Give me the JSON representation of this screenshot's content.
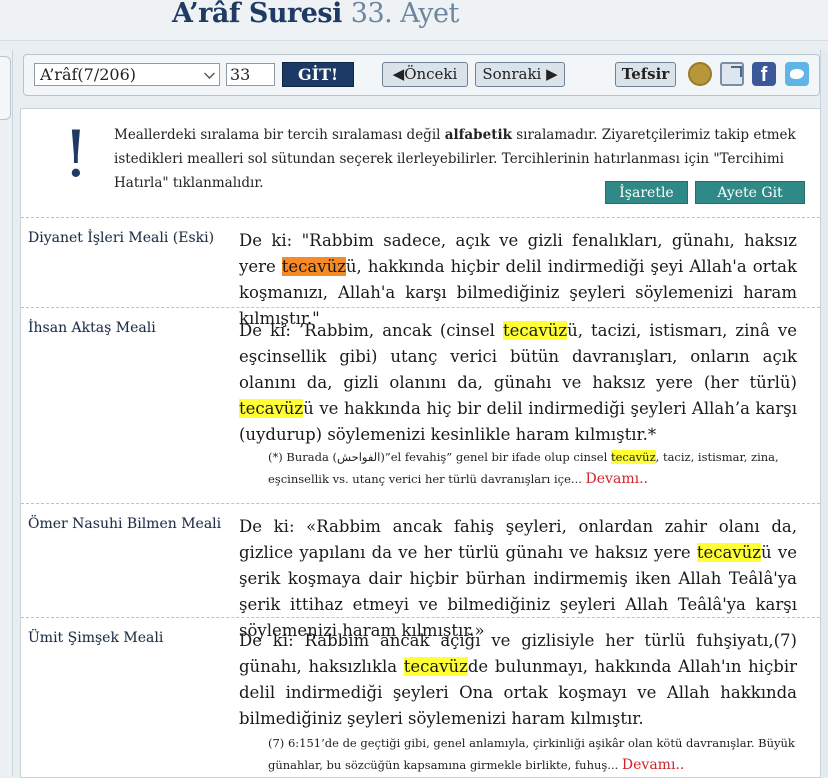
{
  "header": {
    "surah_title": "A’râf Suresi",
    "ayah_title": "33. Ayet"
  },
  "toolbar": {
    "surah_select_value": "A’râf(7/206)",
    "ayah_input_value": "33",
    "go_label": "GİT!",
    "prev_label": "◀Önceki",
    "next_label": "Sonraki ▶",
    "tefsir_label": "Tefsir",
    "fb_label": "f"
  },
  "notice": {
    "icon": "!",
    "part1": "Meallerdeki sıralama bir tercih sıralaması değil ",
    "bold": "alfabetik",
    "part2": " sıralamadır. Ziyaretçilerimiz takip etmek istedikleri mealleri sol sütundan seçerek ilerleyebilirler. Tercihlerinin hatırlanması için \"Tercihimi Hatırla\" tıklanmalıdır.",
    "mark_label": "İşaretle",
    "goto_label": "Ayete Git"
  },
  "translations": [
    {
      "name": "Diyanet İşleri Meali (Eski)",
      "pre": "De ki: \"Rabbim sadece, açık ve gizli fenalıkları, günahı, haksız yere ",
      "hl": "tecavüz",
      "post": "ü, hakkında hiçbir delil indirmediği şeyi Allah'a ortak koşmanızı, Allah'a karşı bilmediğiniz şeyleri söylemenizi haram kılmıştır.\""
    },
    {
      "name": "İhsan Aktaş Meali",
      "pre": "De ki: ’Rabbim, ancak (cinsel ",
      "hl": "tecavüz",
      "mid": "ü, tacizi, istismarı, zinâ ve eşcinsellik gibi) utanç verici bütün davranışları, onların açık olanını da, gizli olanını da, günahı ve haksız yere (her türlü) ",
      "hl2": "tecavüz",
      "post": "ü ve hakkında hiç bir delil indirmediği şeyleri Allah’a karşı (uydurup) söylemenizi kesinlikle haram kılmıştır.*",
      "note_pre": "(*) Burada (الفواحش)”el fevahiş” genel bir ifade olup cinsel ",
      "note_hl": "tecavüz",
      "note_post": ", taciz, istismar, zina, eşcinsellik vs. utanç verici her türlü davranışları içe...",
      "more": "Devamı.."
    },
    {
      "name": "Ömer Nasuhi Bilmen Meali",
      "pre": "De ki: «Rabbim ancak fahiş şeyleri, onlardan zahir olanı da, gizlice yapılanı da ve her türlü günahı ve haksız yere ",
      "hl": "tecavüz",
      "post": "ü ve şerik koşmaya dair hiçbir bürhan indirmemiş iken Allah Teâlâ'ya şerik ittihaz etmeyi ve bilmediğiniz şeyleri Allah Teâlâ'ya karşı söylemenizi haram kılmıştır.»"
    },
    {
      "name": "Ümit Şimşek Meali",
      "pre": "De ki: Rabbim ancak açığı ve gizlisiyle her türlü fuhşiyatı,(7) günahı, haksızlıkla ",
      "hl": "tecavüz",
      "post": "de bulunmayı, hakkında Allah'ın hiçbir delil indirmediği şeyleri Ona ortak koşmayı ve Allah hakkında bilmediğiniz şeyleri söylemenizi haram kılmıştır.",
      "note_text": "(7) 6:151’de de geçtiği gibi, genel anlamıyla, çirkinliği aşikâr olan kötü davranışlar. Büyük günahlar, bu sözcüğün kapsamına girmekle birlikte, fuhuş...",
      "more": "Devamı.."
    }
  ]
}
